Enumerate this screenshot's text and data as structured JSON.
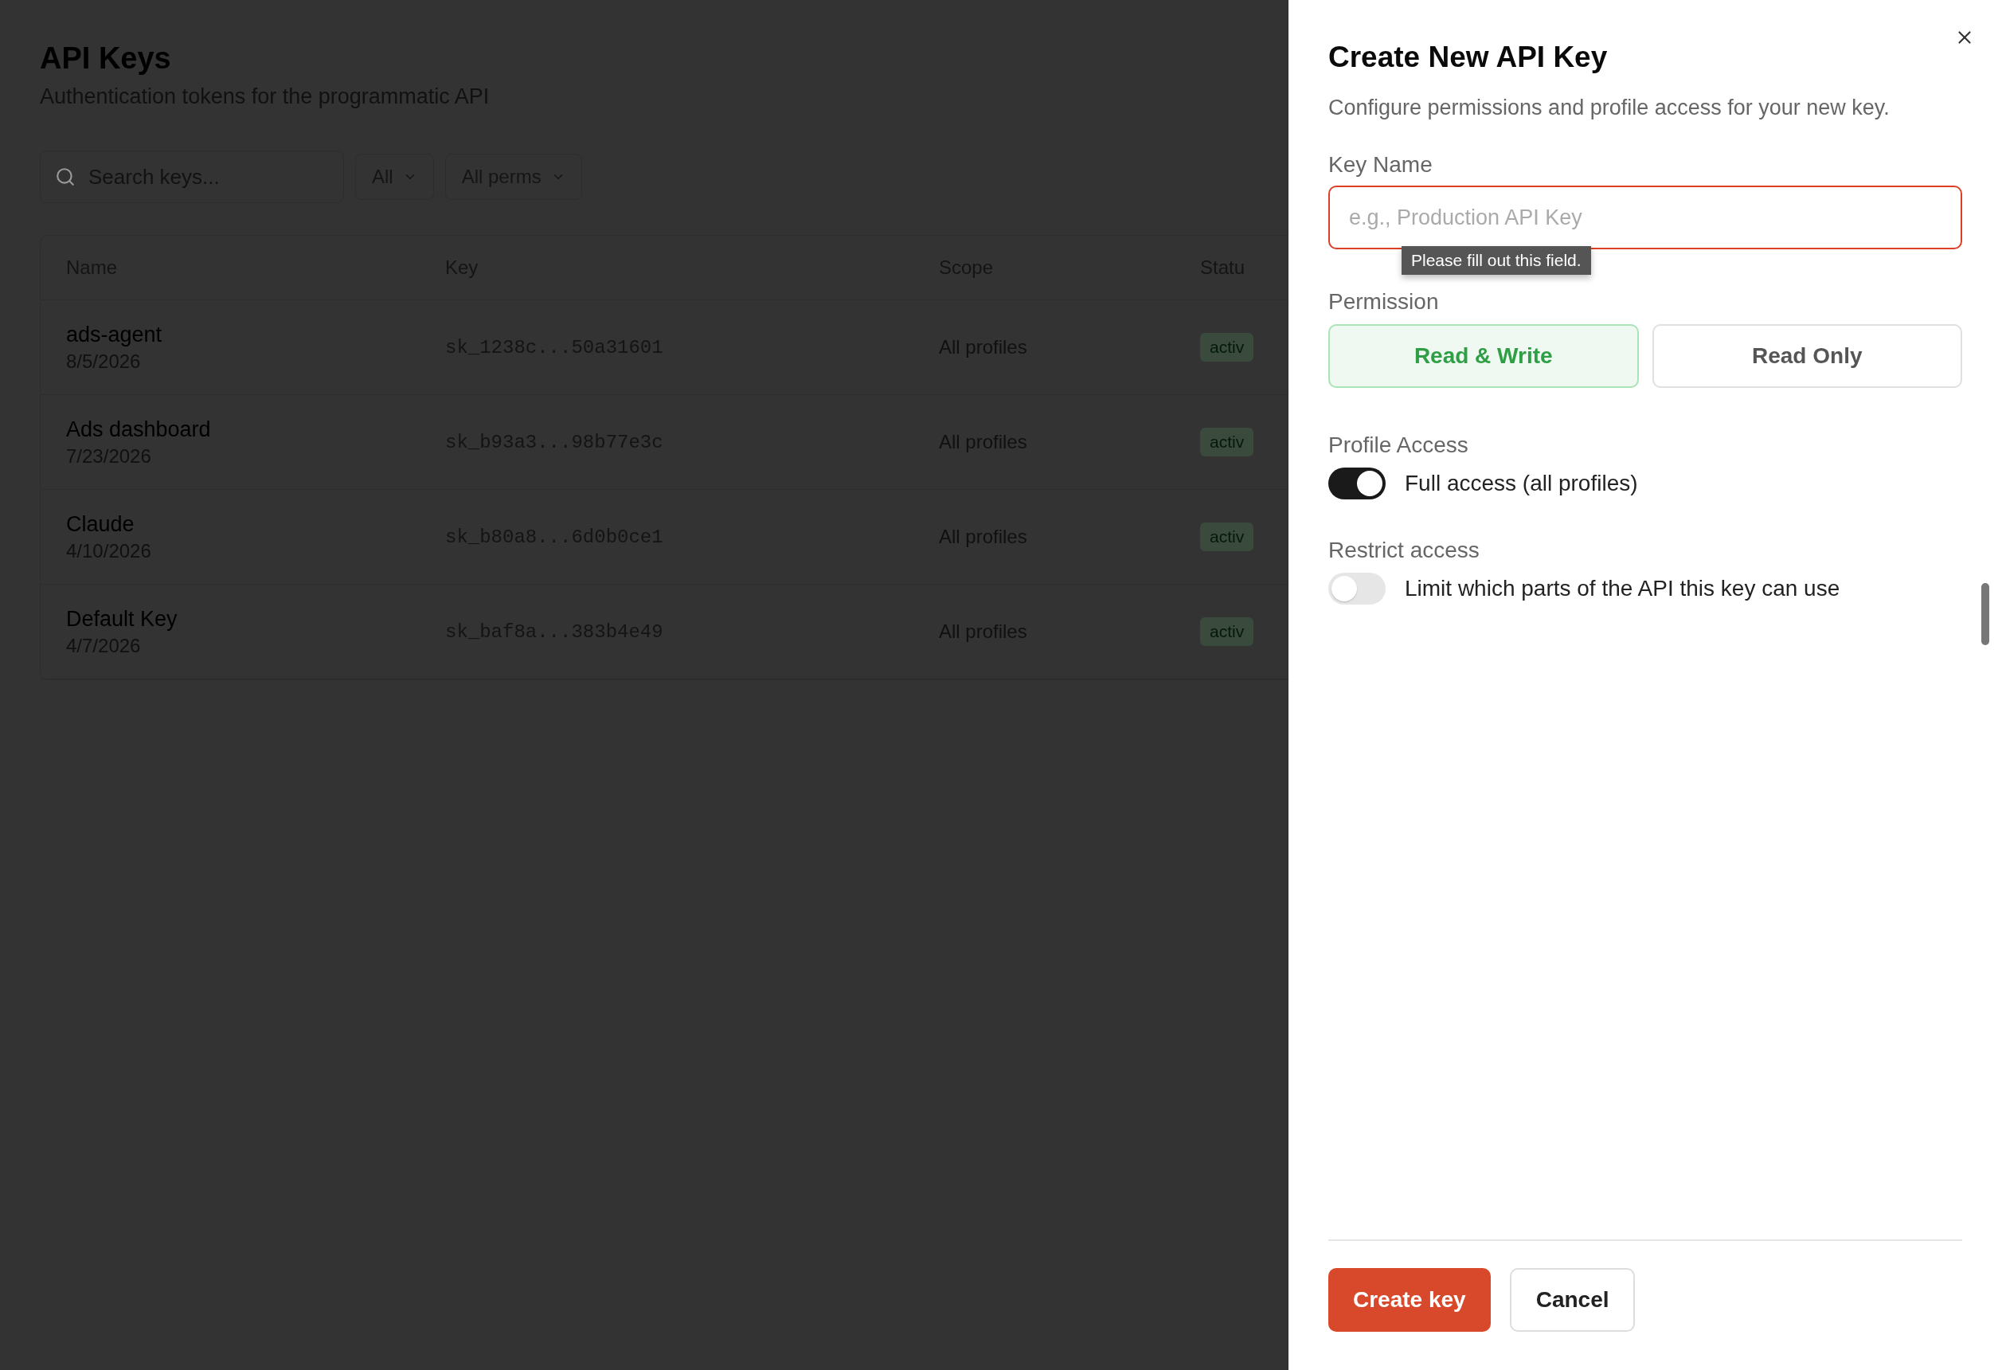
{
  "page": {
    "title": "API Keys",
    "subtitle": "Authentication tokens for the programmatic API",
    "search": {
      "placeholder": "Search keys..."
    },
    "filters": [
      {
        "label": "All"
      },
      {
        "label": "All perms"
      }
    ],
    "table": {
      "columns": [
        "Name",
        "Key",
        "Scope",
        "Statu"
      ],
      "rows": [
        {
          "name": "ads-agent",
          "date": "8/5/2026",
          "key": "sk_1238c...50a31601",
          "scope": "All profiles",
          "status": "activ"
        },
        {
          "name": "Ads dashboard",
          "date": "7/23/2026",
          "key": "sk_b93a3...98b77e3c",
          "scope": "All profiles",
          "status": "activ"
        },
        {
          "name": "Claude",
          "date": "4/10/2026",
          "key": "sk_b80a8...6d0b0ce1",
          "scope": "All profiles",
          "status": "activ"
        },
        {
          "name": "Default Key",
          "date": "4/7/2026",
          "key": "sk_baf8a...383b4e49",
          "scope": "All profiles",
          "status": "activ"
        }
      ]
    }
  },
  "dialog": {
    "title": "Create New API Key",
    "description": "Configure permissions and profile access for your new key.",
    "key_name": {
      "label": "Key Name",
      "placeholder": "e.g., Production API Key",
      "tooltip": "Please fill out this field."
    },
    "permission": {
      "label": "Permission",
      "options": [
        {
          "label": "Read & Write",
          "selected": true
        },
        {
          "label": "Read Only",
          "selected": false
        }
      ]
    },
    "toggles": [
      {
        "heading": "Profile Access",
        "label": "Full access (all profiles)",
        "on": true
      },
      {
        "heading": "Restrict access",
        "label": "Limit which parts of the API this key can use",
        "on": false
      }
    ],
    "buttons": [
      {
        "label": "Create key",
        "kind": "primary"
      },
      {
        "label": "Cancel",
        "kind": "secondary"
      }
    ]
  }
}
